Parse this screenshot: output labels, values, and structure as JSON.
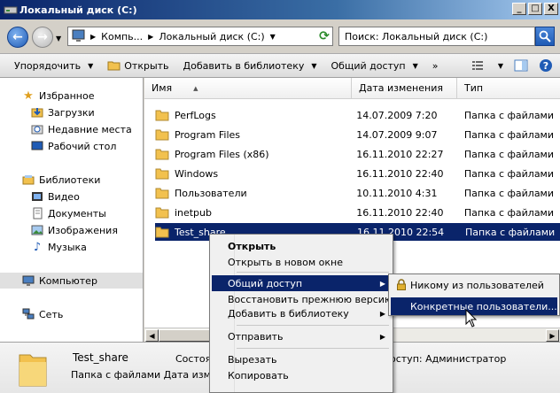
{
  "window": {
    "title": "Локальный диск (C:)",
    "controls": {
      "minimize": "_",
      "maximize": "□",
      "close": "X"
    }
  },
  "address": {
    "crumbs": [
      "Компь...",
      "Локальный диск (C:)"
    ],
    "search_placeholder": "Поиск: Локальный диск (C:)"
  },
  "toolbar": {
    "organize": "Упорядочить",
    "open": "Открыть",
    "add_library": "Добавить в библиотеку",
    "share": "Общий доступ",
    "more": "»"
  },
  "nav": {
    "favorites": "Избранное",
    "downloads": "Загрузки",
    "recent": "Недавние места",
    "desktop": "Рабочий стол",
    "libraries": "Библиотеки",
    "video": "Видео",
    "documents": "Документы",
    "images": "Изображения",
    "music": "Музыка",
    "computer": "Компьютер",
    "network": "Сеть"
  },
  "columns": {
    "name": "Имя",
    "date": "Дата изменения",
    "type": "Тип"
  },
  "files": [
    {
      "name": "PerfLogs",
      "date": "14.07.2009 7:20",
      "type": "Папка с файлами"
    },
    {
      "name": "Program Files",
      "date": "14.07.2009 9:07",
      "type": "Папка с файлами"
    },
    {
      "name": "Program Files (x86)",
      "date": "16.11.2010 22:27",
      "type": "Папка с файлами"
    },
    {
      "name": "Windows",
      "date": "16.11.2010 22:40",
      "type": "Папка с файлами"
    },
    {
      "name": "Пользователи",
      "date": "10.11.2010 4:31",
      "type": "Папка с файлами"
    },
    {
      "name": "inetpub",
      "date": "16.11.2010 22:40",
      "type": "Папка с файлами"
    },
    {
      "name": "Test_share",
      "date": "16.11.2010 22:54",
      "type": "Папка с файлами"
    }
  ],
  "context_menu": {
    "open": "Открыть",
    "open_new": "Открыть в новом окне",
    "share": "Общий доступ",
    "restore": "Восстановить прежнюю версию",
    "add_library": "Добавить в библиотеку",
    "send_to": "Отправить",
    "cut": "Вырезать",
    "copy": "Копировать"
  },
  "submenu": {
    "nobody": "Никому из пользователей",
    "specific": "Конкретные пользователи..."
  },
  "details": {
    "name": "Test_share",
    "type_line": "Папка с файлами Дата изменения",
    "state_label": "Состоян",
    "access": "оступ: Администратор"
  },
  "colors": {
    "selection": "#0a246a",
    "folder": "#f2c14e"
  }
}
